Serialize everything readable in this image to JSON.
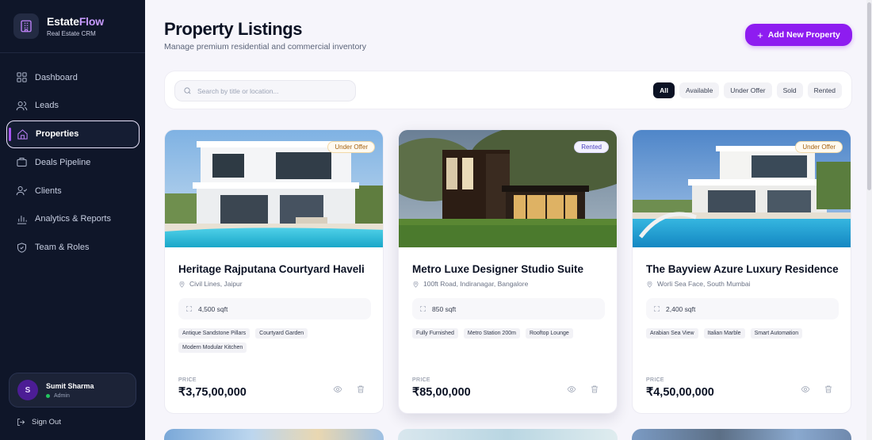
{
  "brand": {
    "name_part1": "Estate",
    "name_part2": "Flow",
    "subtitle": "Real Estate CRM"
  },
  "nav": {
    "items": [
      {
        "label": "Dashboard",
        "icon": "grid-icon",
        "active": false
      },
      {
        "label": "Leads",
        "icon": "users-icon",
        "active": false
      },
      {
        "label": "Properties",
        "icon": "home-icon",
        "active": true
      },
      {
        "label": "Deals Pipeline",
        "icon": "briefcase-icon",
        "active": false
      },
      {
        "label": "Clients",
        "icon": "user-check-icon",
        "active": false
      },
      {
        "label": "Analytics & Reports",
        "icon": "bar-chart-icon",
        "active": false
      },
      {
        "label": "Team & Roles",
        "icon": "shield-icon",
        "active": false
      }
    ]
  },
  "user": {
    "initial": "S",
    "name": "Sumit Sharma",
    "role": "Admin"
  },
  "signout_label": "Sign Out",
  "header": {
    "title": "Property Listings",
    "subtitle": "Manage premium residential and commercial inventory",
    "add_button": "Add New Property"
  },
  "search": {
    "placeholder": "Search by title or location..."
  },
  "filters": [
    "All",
    "Available",
    "Under Offer",
    "Sold",
    "Rented"
  ],
  "active_filter": "All",
  "properties": [
    {
      "status": "Under Offer",
      "title": "Heritage Rajputana Courtyard Haveli",
      "location": "Civil Lines, Jaipur",
      "area": "4,500 sqft",
      "tags": [
        "Antique Sandstone Pillars",
        "Courtyard Garden",
        "Modern Modular Kitchen"
      ],
      "price_label": "PRICE",
      "price": "₹3,75,00,000"
    },
    {
      "status": "Rented",
      "title": "Metro Luxe Designer Studio Suite",
      "location": "100ft Road, Indiranagar, Bangalore",
      "area": "850 sqft",
      "tags": [
        "Fully Furnished",
        "Metro Station 200m",
        "Rooftop Lounge"
      ],
      "price_label": "PRICE",
      "price": "₹85,00,000"
    },
    {
      "status": "Under Offer",
      "title": "The Bayview Azure Luxury Residence",
      "location": "Worli Sea Face, South Mumbai",
      "area": "2,400 sqft",
      "tags": [
        "Arabian Sea View",
        "Italian Marble",
        "Smart Automation"
      ],
      "price_label": "PRICE",
      "price": "₹4,50,00,000"
    }
  ],
  "colors": {
    "accent": "#8e1cf0",
    "sidebar_bg": "#0f1629",
    "background": "#f6f5fb"
  }
}
